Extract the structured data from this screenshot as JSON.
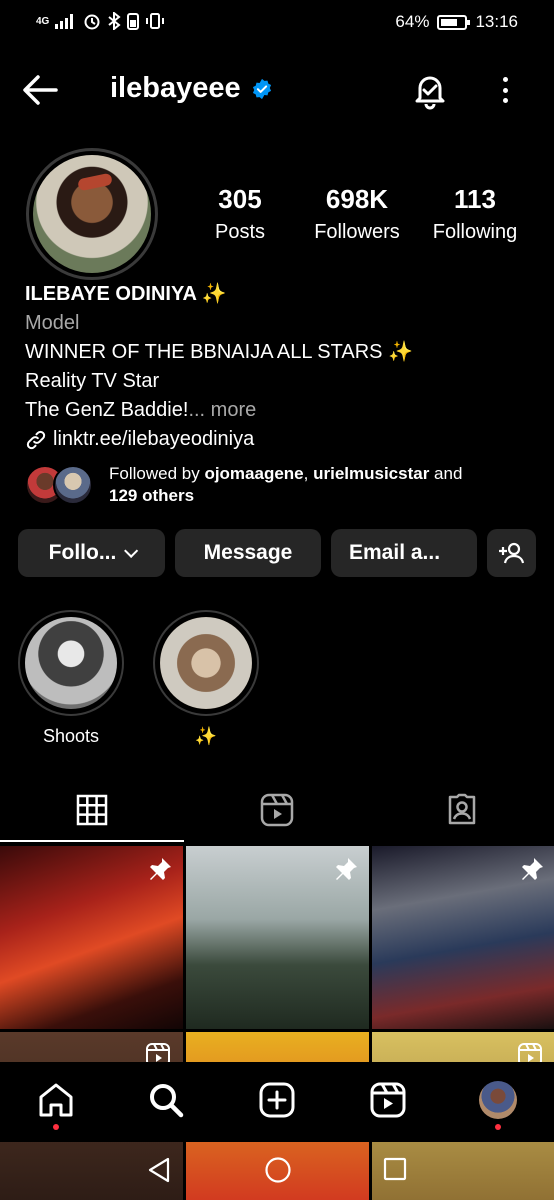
{
  "status_bar": {
    "network": "4G",
    "battery_percent": "64%",
    "time": "13:16"
  },
  "header": {
    "username": "ilebayeee",
    "verified": true,
    "icons": [
      "back-arrow-icon",
      "verified-badge-icon",
      "notification-bell-icon",
      "more-options-icon"
    ]
  },
  "stats": {
    "posts": {
      "value": "305",
      "label": "Posts"
    },
    "followers": {
      "value": "698K",
      "label": "Followers"
    },
    "following": {
      "value": "113",
      "label": "Following"
    }
  },
  "bio": {
    "name": "ILEBAYE ODINIYA ✨",
    "category": "Model",
    "line1": "WINNER OF THE BBNAIJA ALL STARS ✨",
    "line2": "Reality TV Star",
    "line3": "The GenZ Baddie!",
    "more": "... more",
    "link": "linktr.ee/ilebayeodiniya"
  },
  "followed_by": {
    "prefix": "Followed by ",
    "user1": "ojomaagene",
    "sep": ", ",
    "user2": "urielmusicstar",
    "and": " and",
    "others": "129 others"
  },
  "actions": {
    "follow": "Follo...",
    "message": "Message",
    "email": "Email a..."
  },
  "highlights": [
    {
      "label": "Shoots"
    },
    {
      "label": "✨"
    }
  ],
  "tabs": [
    "grid",
    "reels",
    "tagged"
  ],
  "colors": {
    "background": "#000000",
    "button": "#262626",
    "secondary_text": "#a8a8a8",
    "verified": "#0095f6",
    "notification_dot": "#ff3040"
  }
}
